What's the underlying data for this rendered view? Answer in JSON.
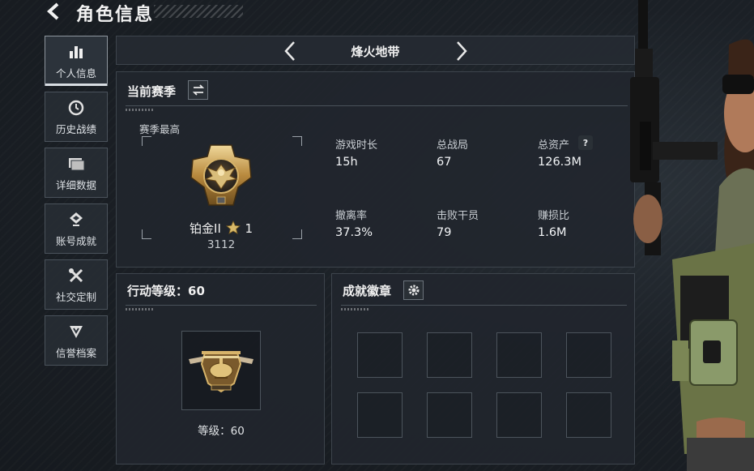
{
  "header": {
    "title": "角色信息"
  },
  "sidebar": {
    "items": [
      {
        "label": "个人信息",
        "icon": "bar-chart-icon",
        "active": true
      },
      {
        "label": "历史战绩",
        "icon": "clock-icon"
      },
      {
        "label": "详细数据",
        "icon": "folder-icon"
      },
      {
        "label": "账号成就",
        "icon": "trophy-icon"
      },
      {
        "label": "社交定制",
        "icon": "tools-icon"
      },
      {
        "label": "信誉档案",
        "icon": "shield-icon"
      }
    ]
  },
  "map_selector": {
    "name": "烽火地带"
  },
  "season": {
    "title": "当前赛季",
    "best_label": "赛季最高",
    "rank_name": "铂金II",
    "rank_stars": "1",
    "rank_points": "3112",
    "stats": [
      {
        "label": "游戏时长",
        "value": "15h"
      },
      {
        "label": "总战局",
        "value": "67"
      },
      {
        "label": "总资产",
        "value": "126.3M",
        "has_help": true
      },
      {
        "label": "撤离率",
        "value": "37.3%"
      },
      {
        "label": "击败干员",
        "value": "79"
      },
      {
        "label": "赚损比",
        "value": "1.6M"
      }
    ],
    "help_icon_text": "?"
  },
  "action_level": {
    "title": "行动等级：60",
    "level_text": "等级：60"
  },
  "achievements": {
    "title": "成就徽章",
    "slots": 8
  },
  "colors": {
    "background": "#1a1f25",
    "panel": "#21262d",
    "border": "#3d444c",
    "gold": "#c9a45a",
    "text": "#e6e8ea"
  }
}
